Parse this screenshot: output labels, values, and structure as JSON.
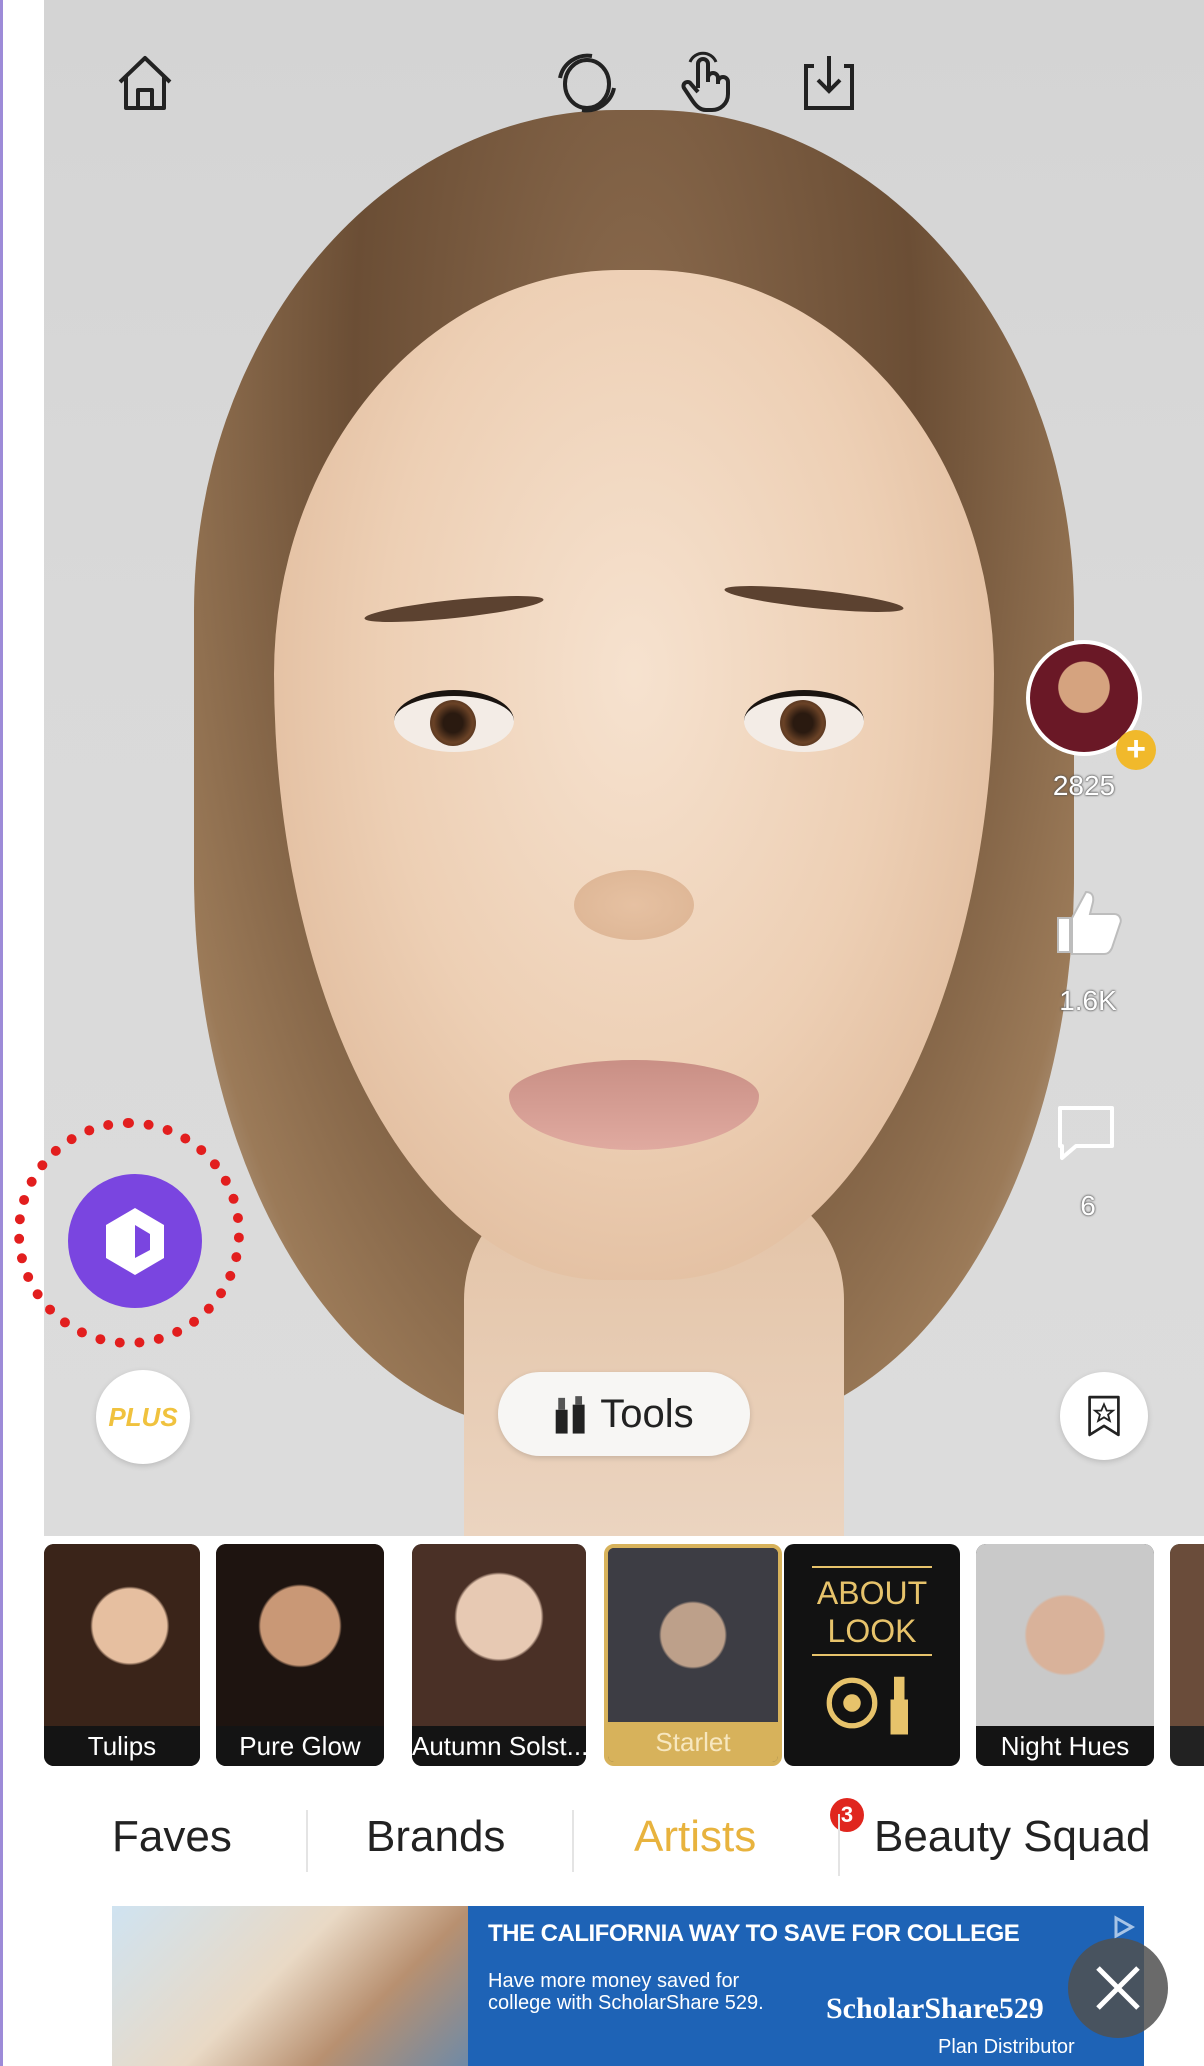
{
  "toolbar": {
    "home_icon": "home-icon",
    "face_icon": "face-swap-icon",
    "touch_icon": "touch-hand-icon",
    "save_icon": "download-icon"
  },
  "creator": {
    "followers": "2825",
    "likes": "1.6K",
    "comments": "6"
  },
  "controls": {
    "plus_label": "PLUS",
    "tools_label": "Tools"
  },
  "looks": [
    {
      "label": "Tulips",
      "selected": false
    },
    {
      "label": "Pure Glow",
      "selected": false
    },
    {
      "label": "Autumn Solst...",
      "selected": false
    },
    {
      "label": "Starlet",
      "selected": true
    },
    {
      "label": "",
      "card": "ABOUT LOOK",
      "selected": false
    },
    {
      "label": "Night Hues",
      "selected": false
    }
  ],
  "about_card": {
    "line1": "ABOUT",
    "line2": "LOOK"
  },
  "tabs": [
    {
      "label": "Faves",
      "active": false
    },
    {
      "label": "Brands",
      "active": false
    },
    {
      "label": "Artists",
      "active": true,
      "badge": "3"
    },
    {
      "label": "Beauty Squad",
      "active": false
    }
  ],
  "ad": {
    "headline": "THE CALIFORNIA WAY TO SAVE FOR COLLEGE",
    "body": "Have more money saved for college with ScholarShare 529.",
    "brand": "ScholarShare529",
    "distributor": "Plan Distributor"
  },
  "colors": {
    "accent_gold": "#e8b33e",
    "purple_button": "#7a45e0",
    "highlight_ring": "#e21e1e",
    "ad_blue": "#1e63b6"
  }
}
